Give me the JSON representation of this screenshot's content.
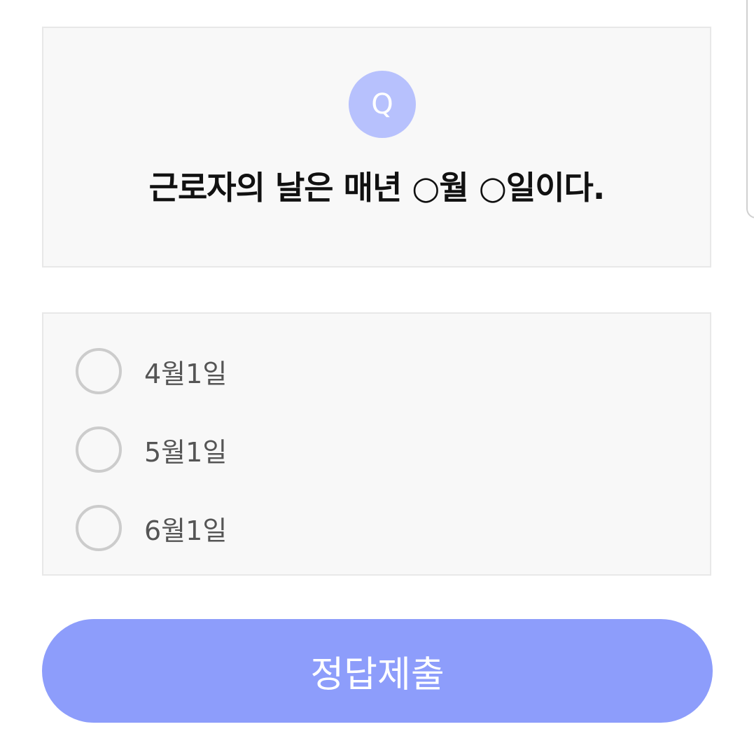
{
  "question": {
    "badge": "Q",
    "text": "근로자의 날은 매년 ○월 ○일이다."
  },
  "options": [
    {
      "label": "4월1일",
      "selected": false
    },
    {
      "label": "5월1일",
      "selected": false
    },
    {
      "label": "6월1일",
      "selected": false
    }
  ],
  "submit": {
    "label": "정답제출"
  },
  "colors": {
    "accent": "#8d9dfb",
    "badge": "#b7c1fd",
    "card_bg": "#f8f8f8",
    "radio_border": "#cccccc"
  }
}
